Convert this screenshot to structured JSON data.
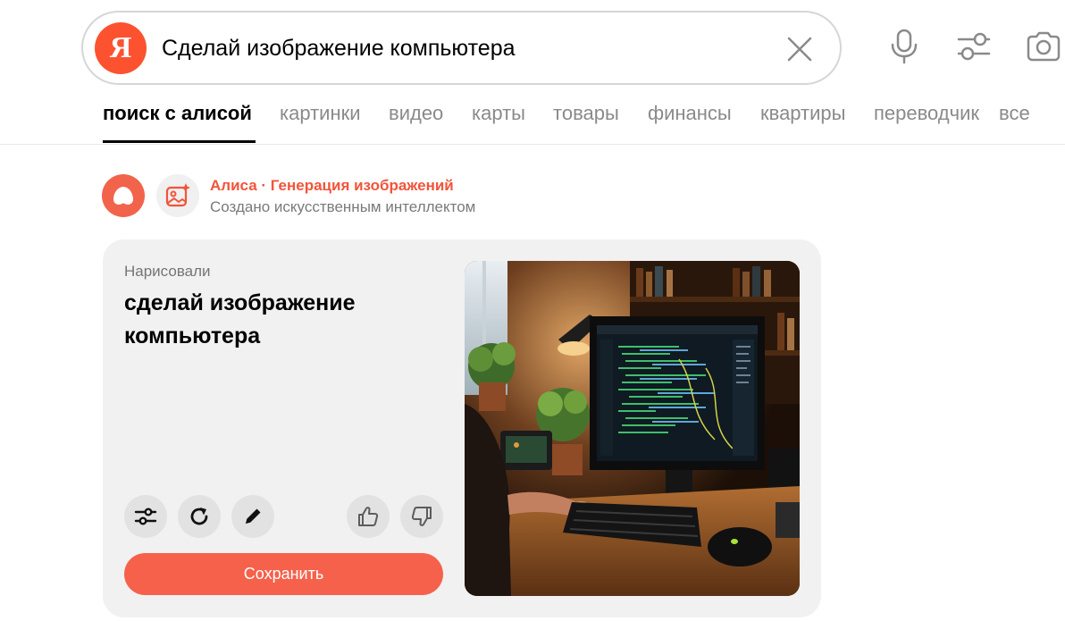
{
  "search": {
    "logo_letter": "Я",
    "query": "Сделай изображение компьютера"
  },
  "tabs": [
    {
      "label": "поиск с алисой",
      "active": true
    },
    {
      "label": "картинки",
      "active": false
    },
    {
      "label": "видео",
      "active": false
    },
    {
      "label": "карты",
      "active": false
    },
    {
      "label": "товары",
      "active": false
    },
    {
      "label": "финансы",
      "active": false
    },
    {
      "label": "квартиры",
      "active": false
    },
    {
      "label": "переводчик",
      "active": false
    },
    {
      "label": "все",
      "active": false
    }
  ],
  "source": {
    "title": "Алиса · Генерация изображений",
    "subtitle": "Создано искусственным интеллектом"
  },
  "card": {
    "eyebrow": "Нарисовали",
    "title": "сделай изображение компьютера",
    "save_label": "Сохранить",
    "actions": [
      "settings-icon",
      "refresh-icon",
      "pencil-icon",
      "thumbs-up-icon",
      "thumbs-down-icon"
    ]
  },
  "colors": {
    "accent": "#fc5230",
    "alice": "#f2634b",
    "save_button": "#f6614b",
    "source_title": "#f2543a",
    "card_background": "#f1f1f1"
  }
}
